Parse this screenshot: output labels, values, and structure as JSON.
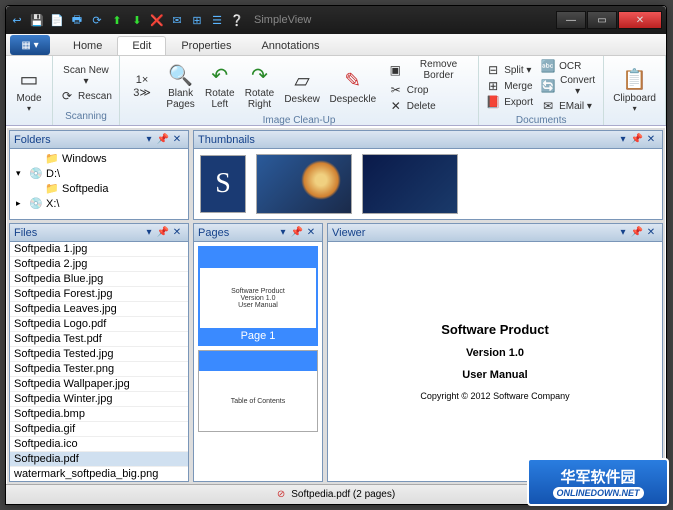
{
  "window": {
    "title": "SimpleView"
  },
  "win_controls": {
    "min": "—",
    "max": "▭",
    "close": "✕"
  },
  "tabs": {
    "home": "Home",
    "edit": "Edit",
    "properties": "Properties",
    "annotations": "Annotations",
    "app_icon": "▦ ▾"
  },
  "ribbon": {
    "mode": "Mode",
    "scan_new": "Scan New ▾",
    "rescan": "Rescan",
    "scanning": "Scanning",
    "onex": "1×\n3≫",
    "blank_pages": "Blank\nPages",
    "rotate_left": "Rotate\nLeft",
    "rotate_right": "Rotate\nRight",
    "deskew": "Deskew",
    "despeckle": "Despeckle",
    "remove_border": "Remove Border",
    "crop": "Crop",
    "delete": "Delete",
    "image_cleanup": "Image Clean-Up",
    "split": "Split ▾",
    "merge": "Merge",
    "export": "Export",
    "ocr": "OCR",
    "convert": "Convert ▾",
    "email": "EMail ▾",
    "documents": "Documents",
    "clipboard": "Clipboard"
  },
  "panels": {
    "folders": "Folders",
    "files": "Files",
    "thumbnails": "Thumbnails",
    "pages": "Pages",
    "viewer": "Viewer"
  },
  "folders": {
    "items": [
      {
        "indent": 1,
        "icon": "📁",
        "label": "Windows",
        "exp": ""
      },
      {
        "indent": 0,
        "icon": "💿",
        "label": "D:\\",
        "exp": "▾"
      },
      {
        "indent": 1,
        "icon": "📁",
        "label": "Softpedia",
        "exp": ""
      },
      {
        "indent": 0,
        "icon": "💿",
        "label": "X:\\",
        "exp": "▸"
      }
    ]
  },
  "files": {
    "items": [
      "Softpedia 1.jpg",
      "Softpedia 2.jpg",
      "Softpedia Blue.jpg",
      "Softpedia Forest.jpg",
      "Softpedia Leaves.jpg",
      "Softpedia Logo.pdf",
      "Softpedia Test.pdf",
      "Softpedia Tested.jpg",
      "Softpedia Tester.png",
      "Softpedia Wallpaper.jpg",
      "Softpedia Winter.jpg",
      "Softpedia.bmp",
      "Softpedia.gif",
      "Softpedia.ico",
      "Softpedia.pdf",
      "watermark_softpedia_big.png"
    ],
    "selected": 14
  },
  "thumbs": {
    "s_letter": "S"
  },
  "pages": {
    "page1_label": "Page 1",
    "page1_text": "Software Product\nVersion 1.0\nUser Manual",
    "page2_text": "Table of Contents"
  },
  "viewer": {
    "line1": "Software Product",
    "line2": "Version 1.0",
    "line3": "User Manual",
    "line4": "Copyright © 2012 Software Company"
  },
  "status": {
    "icon": "⊘",
    "text": "Softpedia.pdf (2 pages)"
  },
  "overlay": {
    "cn": "华军软件园",
    "en": "ONLINEDOWN.NET"
  }
}
